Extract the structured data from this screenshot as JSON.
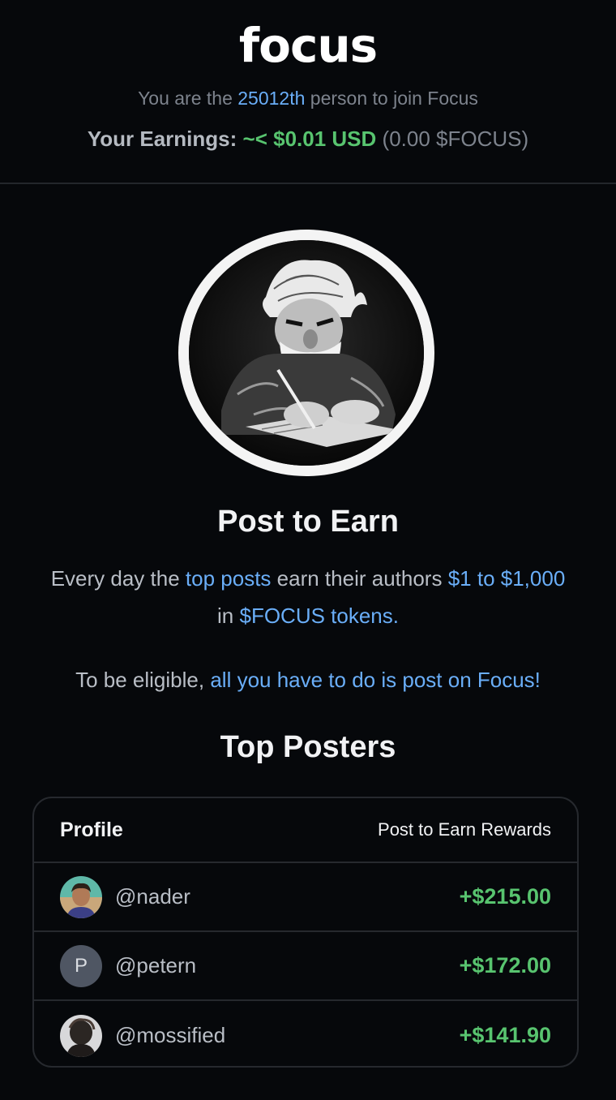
{
  "header": {
    "logo": "focus",
    "join_prefix": "You are the",
    "join_rank": "25012th",
    "join_suffix": "person to join Focus",
    "earnings_label": "Your Earnings:",
    "earnings_usd": "~< $0.01 USD",
    "earnings_token": "(0.00 $FOCUS)"
  },
  "post_to_earn": {
    "title": "Post to Earn",
    "line1_a": "Every day the",
    "line1_b": "top posts",
    "line1_c": "earn their authors",
    "line1_d": "$1 to $1,000",
    "line1_e": "in",
    "line1_f": "$FOCUS tokens.",
    "line2_a": "To be eligible,",
    "line2_b": "all you have to do is post on Focus!"
  },
  "top_posters": {
    "title": "Top Posters",
    "col_profile": "Profile",
    "col_rewards": "Post to Earn Rewards",
    "rows": [
      {
        "handle": "@nader",
        "reward": "+$215.00"
      },
      {
        "handle": "@petern",
        "initial": "P",
        "reward": "+$172.00"
      },
      {
        "handle": "@mossified",
        "reward": "+$141.90"
      }
    ]
  },
  "colors": {
    "accent_blue": "#6aaef8",
    "money_green": "#58c46f",
    "background": "#06080b"
  }
}
